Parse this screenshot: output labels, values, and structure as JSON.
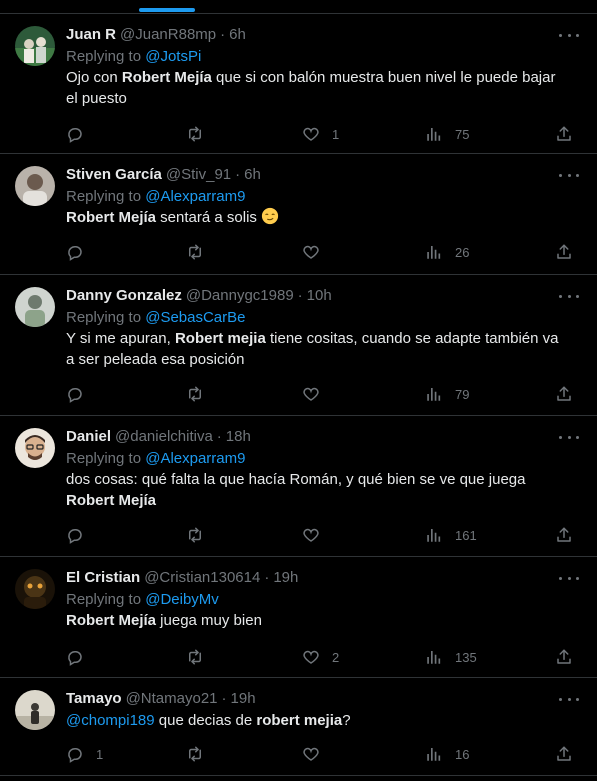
{
  "colors": {
    "background": "#000000",
    "text": "#e7e9ea",
    "muted": "#71767b",
    "accent": "#1d9bf0",
    "divider": "#2f3336"
  },
  "icons": {
    "reply": "speech-bubble-icon",
    "retweet": "retweet-arrows-icon",
    "like": "heart-icon",
    "views": "bar-chart-icon",
    "share": "upload-arrow-icon",
    "more": "three-dots-icon"
  },
  "tweets": [
    {
      "name": "Juan R",
      "handle": "@JuanR88mp",
      "time": "6h",
      "replying_label": "Replying to ",
      "replying_to": "@JotsPi",
      "text_parts": [
        "Ojo con ",
        "Robert Mejía",
        " que si con balón muestra buen nivel le puede bajar el puesto"
      ],
      "counts": {
        "reply": "",
        "retweet": "",
        "like": "1",
        "views": "75"
      },
      "avatar_color": "#2d5a3a"
    },
    {
      "name": "Stiven García",
      "handle": "@Stiv_91",
      "time": "6h",
      "replying_label": "Replying to ",
      "replying_to": "@Alexparram9",
      "text_parts": [
        "",
        "Robert Mejía",
        " sentará a solis "
      ],
      "emoji": "smirking-face-emoji",
      "counts": {
        "reply": "",
        "retweet": "",
        "like": "",
        "views": "26"
      },
      "avatar_color": "#8c8178"
    },
    {
      "name": "Danny Gonzalez",
      "handle": "@Dannygc1989",
      "time": "10h",
      "replying_label": "Replying to ",
      "replying_to": "@SebasCarBe",
      "text_parts": [
        "Y si me apuran, ",
        "Robert mejia",
        " tiene cositas, cuando se adapte también va a ser peleada esa posición"
      ],
      "counts": {
        "reply": "",
        "retweet": "",
        "like": "",
        "views": "79"
      },
      "avatar_color": "#9aa39a"
    },
    {
      "name": "Daniel",
      "handle": "@danielchitiva",
      "time": "18h",
      "replying_label": "Replying to ",
      "replying_to": "@Alexparram9",
      "text_parts": [
        "dos cosas: qué falta la que hacía Román, y qué bien se ve que juega ",
        "Robert Mejía",
        ""
      ],
      "counts": {
        "reply": "",
        "retweet": "",
        "like": "",
        "views": "161"
      },
      "avatar_color": "#d8cfc4"
    },
    {
      "name": "El Cristian",
      "handle": "@Cristian130614",
      "time": "19h",
      "replying_label": "Replying to ",
      "replying_to": "@DeibyMv",
      "text_parts": [
        "",
        "Robert Mejía",
        " juega muy bien"
      ],
      "counts": {
        "reply": "",
        "retweet": "",
        "like": "2",
        "views": "135"
      },
      "avatar_color": "#3a2a12"
    },
    {
      "name": "Tamayo",
      "handle": "@Ntamayo21",
      "time": "19h",
      "replying_label": "",
      "replying_to": "",
      "lead_mention": "@chompi189",
      "text_parts": [
        " que decias de ",
        "robert mejia",
        "?"
      ],
      "counts": {
        "reply": "1",
        "retweet": "",
        "like": "",
        "views": "16"
      },
      "avatar_color": "#c9c4b8"
    }
  ]
}
